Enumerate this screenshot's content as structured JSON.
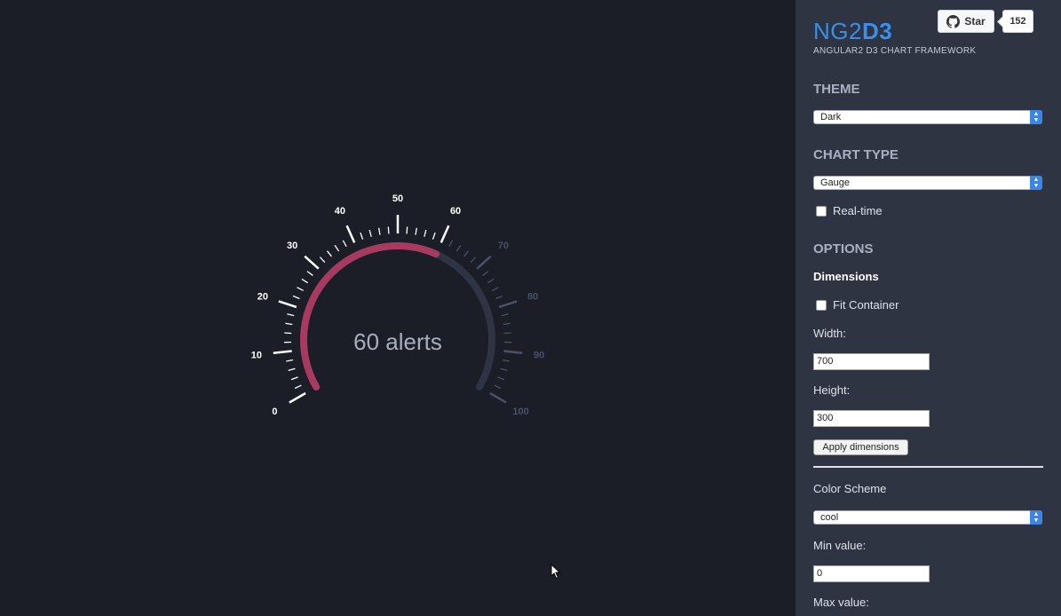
{
  "chart_data": {
    "type": "gauge",
    "value": 60,
    "min": 0,
    "max": 100,
    "center_text": "60 alerts",
    "tick_labels": [
      "0",
      "10",
      "20",
      "30",
      "40",
      "50",
      "60",
      "70",
      "80",
      "90",
      "100"
    ],
    "colors": {
      "value_arc": "#a8395f",
      "track_arc": "#2e3444",
      "active_ticks": "#ffffff",
      "inactive_ticks": "#495168",
      "center_text": "#a9aebc"
    }
  },
  "sidebar": {
    "logo_light": "NG2",
    "logo_bold": "D3",
    "subtitle": "ANGULAR2 D3 CHART FRAMEWORK",
    "github_star_label": "Star",
    "github_star_count": "152",
    "theme_heading": "THEME",
    "theme_value": "Dark",
    "chart_type_heading": "CHART TYPE",
    "chart_type_value": "Gauge",
    "realtime_label": "Real-time",
    "options_heading": "OPTIONS",
    "dimensions_heading": "Dimensions",
    "fit_container_label": "Fit Container",
    "width_label": "Width:",
    "width_value": "700",
    "height_label": "Height:",
    "height_value": "300",
    "apply_button": "Apply dimensions",
    "color_scheme_label": "Color Scheme",
    "color_scheme_value": "cool",
    "min_value_label": "Min value:",
    "min_value": "0",
    "max_value_label": "Max value:"
  }
}
